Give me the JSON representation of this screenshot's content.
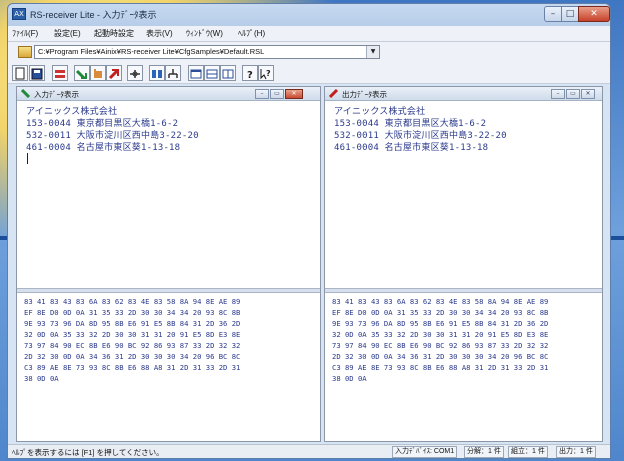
{
  "window": {
    "title": "RS-receiver Lite - 入力ﾃﾞｰﾀ表示"
  },
  "menu": [
    "ﾌｧｲﾙ(F)",
    "設定(E)",
    "起動時設定",
    "表示(V)",
    "ｳｨﾝﾄﾞｳ(W)",
    "ﾍﾙﾌﾟ(H)"
  ],
  "settings_file": {
    "value": "C:¥Program Files¥Ainix¥RS-receiver Lite¥CfgSamples¥Default.RSL"
  },
  "panes": {
    "input": {
      "title": "入力ﾃﾞｰﾀ表示",
      "text_lines": [
        "アイニックス株式会社",
        "153-0044 東京都目黒区大橋1-6-2",
        "532-0011 大阪市淀川区西中島3-22-20",
        "461-0004 名古屋市東区葵1-13-18"
      ],
      "hex_lines": [
        "83 41 83 43 83 6A 83 62 83 4E 83 58 8A 94 8E AE 89",
        "EF 8E D0 0D 0A 31 35 33 2D 30 30 34 34 20 93 8C 8B",
        "9E 93 73 96 DA 8D 95 8B E6 91 E5 8B 84 31 2D 36 2D",
        "32 0D 0A 35 33 32 2D 30 30 31 31 20 91 E5 8D E3 8E",
        "73 97 84 90 EC 8B E6 90 BC 92 86 93 87 33 2D 32 32",
        "2D 32 30 0D 0A 34 36 31 2D 30 30 30 34 20 96 BC 8C",
        "C3 89 AE 8E 73 93 8C 8B E6 88 A8 31 2D 31 33 2D 31",
        "38 0D 0A"
      ]
    },
    "output": {
      "title": "出力ﾃﾞｰﾀ表示",
      "text_lines": [
        "アイニックス株式会社",
        "153-0044 東京都目黒区大橋1-6-2",
        "532-0011 大阪市淀川区西中島3-22-20",
        "461-0004 名古屋市東区葵1-13-18"
      ],
      "hex_lines": [
        "83 41 83 43 83 6A 83 62 83 4E 83 58 8A 94 8E AE 89",
        "EF 8E D0 0D 0A 31 35 33 2D 30 30 34 34 20 93 8C 8B",
        "9E 93 73 96 DA 8D 95 8B E6 91 E5 8B 84 31 2D 36 2D",
        "32 0D 0A 35 33 32 2D 30 30 31 31 20 91 E5 8D E3 8E",
        "73 97 84 90 EC 8B E6 90 BC 92 86 93 87 33 2D 32 32",
        "2D 32 30 0D 0A 34 36 31 2D 30 30 30 34 20 96 BC 8C",
        "C3 89 AE 8E 73 93 8C 8B E6 88 A8 31 2D 31 33 2D 31",
        "38 0D 0A"
      ]
    }
  },
  "status": {
    "hint": "ﾍﾙﾌﾟを表示するには [F1] を押してください。",
    "device": "入力ﾃﾞﾊﾞｲｽ: COM1",
    "split": "分解：1 件",
    "assemble": "組立：1 件",
    "output": "出力：1 件"
  }
}
